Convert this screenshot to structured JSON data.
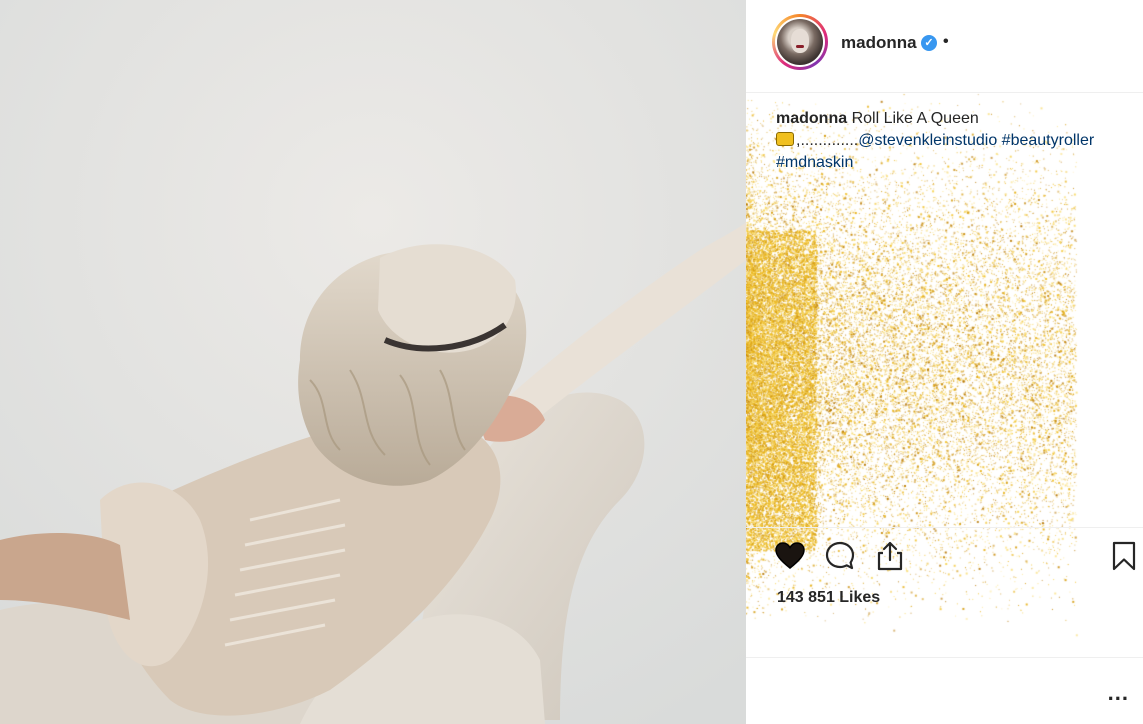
{
  "post": {
    "username": "madonna",
    "verified_mark": "✓",
    "separator": "•",
    "caption_user": "madonna",
    "caption_text": " Roll Like A Queen",
    "caption_dots": ",.............",
    "mention": "@stevenkleinstudio",
    "hashtag_1": "#beautyroller",
    "hashtag_2": "#mdnaskin",
    "likes": "143 851 Likes",
    "more_label": "..."
  },
  "icons": {
    "like": "heart-filled-icon",
    "comment": "comment-icon",
    "share": "share-icon",
    "save": "bookmark-icon",
    "more": "more-options-icon"
  },
  "colors": {
    "link": "#003569",
    "verified": "#3897f0",
    "glitter": "#e8b21a",
    "border": "#efefef"
  }
}
